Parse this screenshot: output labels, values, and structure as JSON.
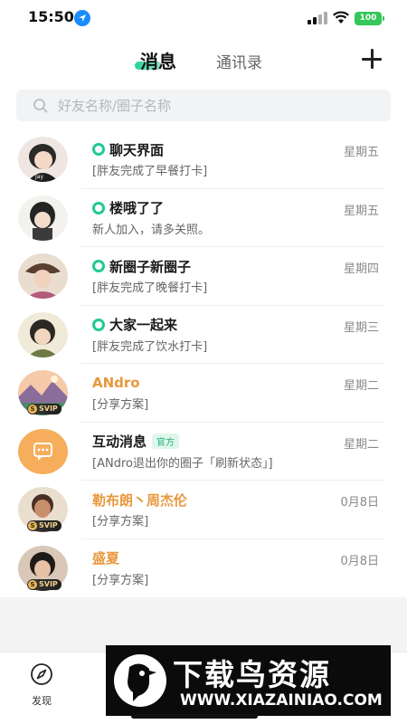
{
  "status_bar": {
    "time": "15:50",
    "battery": "100"
  },
  "header": {
    "tab_active": "消息",
    "tab_inactive": "通讯录",
    "add_icon": "plus-icon"
  },
  "search": {
    "placeholder": "好友名称/圈子名称",
    "icon": "search-icon"
  },
  "chats": [
    {
      "title": "聊天界面",
      "time": "星期五",
      "preview": "[胖友完成了早餐打卡]",
      "type": "group"
    },
    {
      "title": "楼哦了了",
      "time": "星期五",
      "preview": "新人加入，请多关照。",
      "type": "group"
    },
    {
      "title": "新圈子新圈子",
      "time": "星期四",
      "preview": "[胖友完成了晚餐打卡]",
      "type": "group"
    },
    {
      "title": "大家一起来",
      "time": "星期三",
      "preview": "[胖友完成了饮水打卡]",
      "type": "group"
    },
    {
      "title": "ANdro",
      "time": "星期二",
      "preview": "[分享方案]",
      "type": "vip",
      "badge": "SVIP"
    },
    {
      "title": "互动消息",
      "tag": "官方",
      "time": "星期二",
      "preview": "[ANdro退出你的圈子「刷新状态」]",
      "type": "system"
    },
    {
      "title": "勒布朗丶周杰伦",
      "time": "0月8日",
      "preview": "[分享方案]",
      "type": "vip",
      "badge": "SVIP"
    },
    {
      "title": "盛夏",
      "time": "0月8日",
      "preview": "[分享方案]",
      "type": "vip",
      "badge": "SVIP"
    }
  ],
  "tab_bar": {
    "discover_label": "发现",
    "discover_icon": "compass-icon"
  },
  "watermark": {
    "title": "下载鸟资源",
    "url": "WWW.XIAZAINIAO.COM"
  },
  "colors": {
    "accent": "#20c997",
    "vip_name": "#e8983c",
    "system_avatar": "#f6ae5c"
  }
}
